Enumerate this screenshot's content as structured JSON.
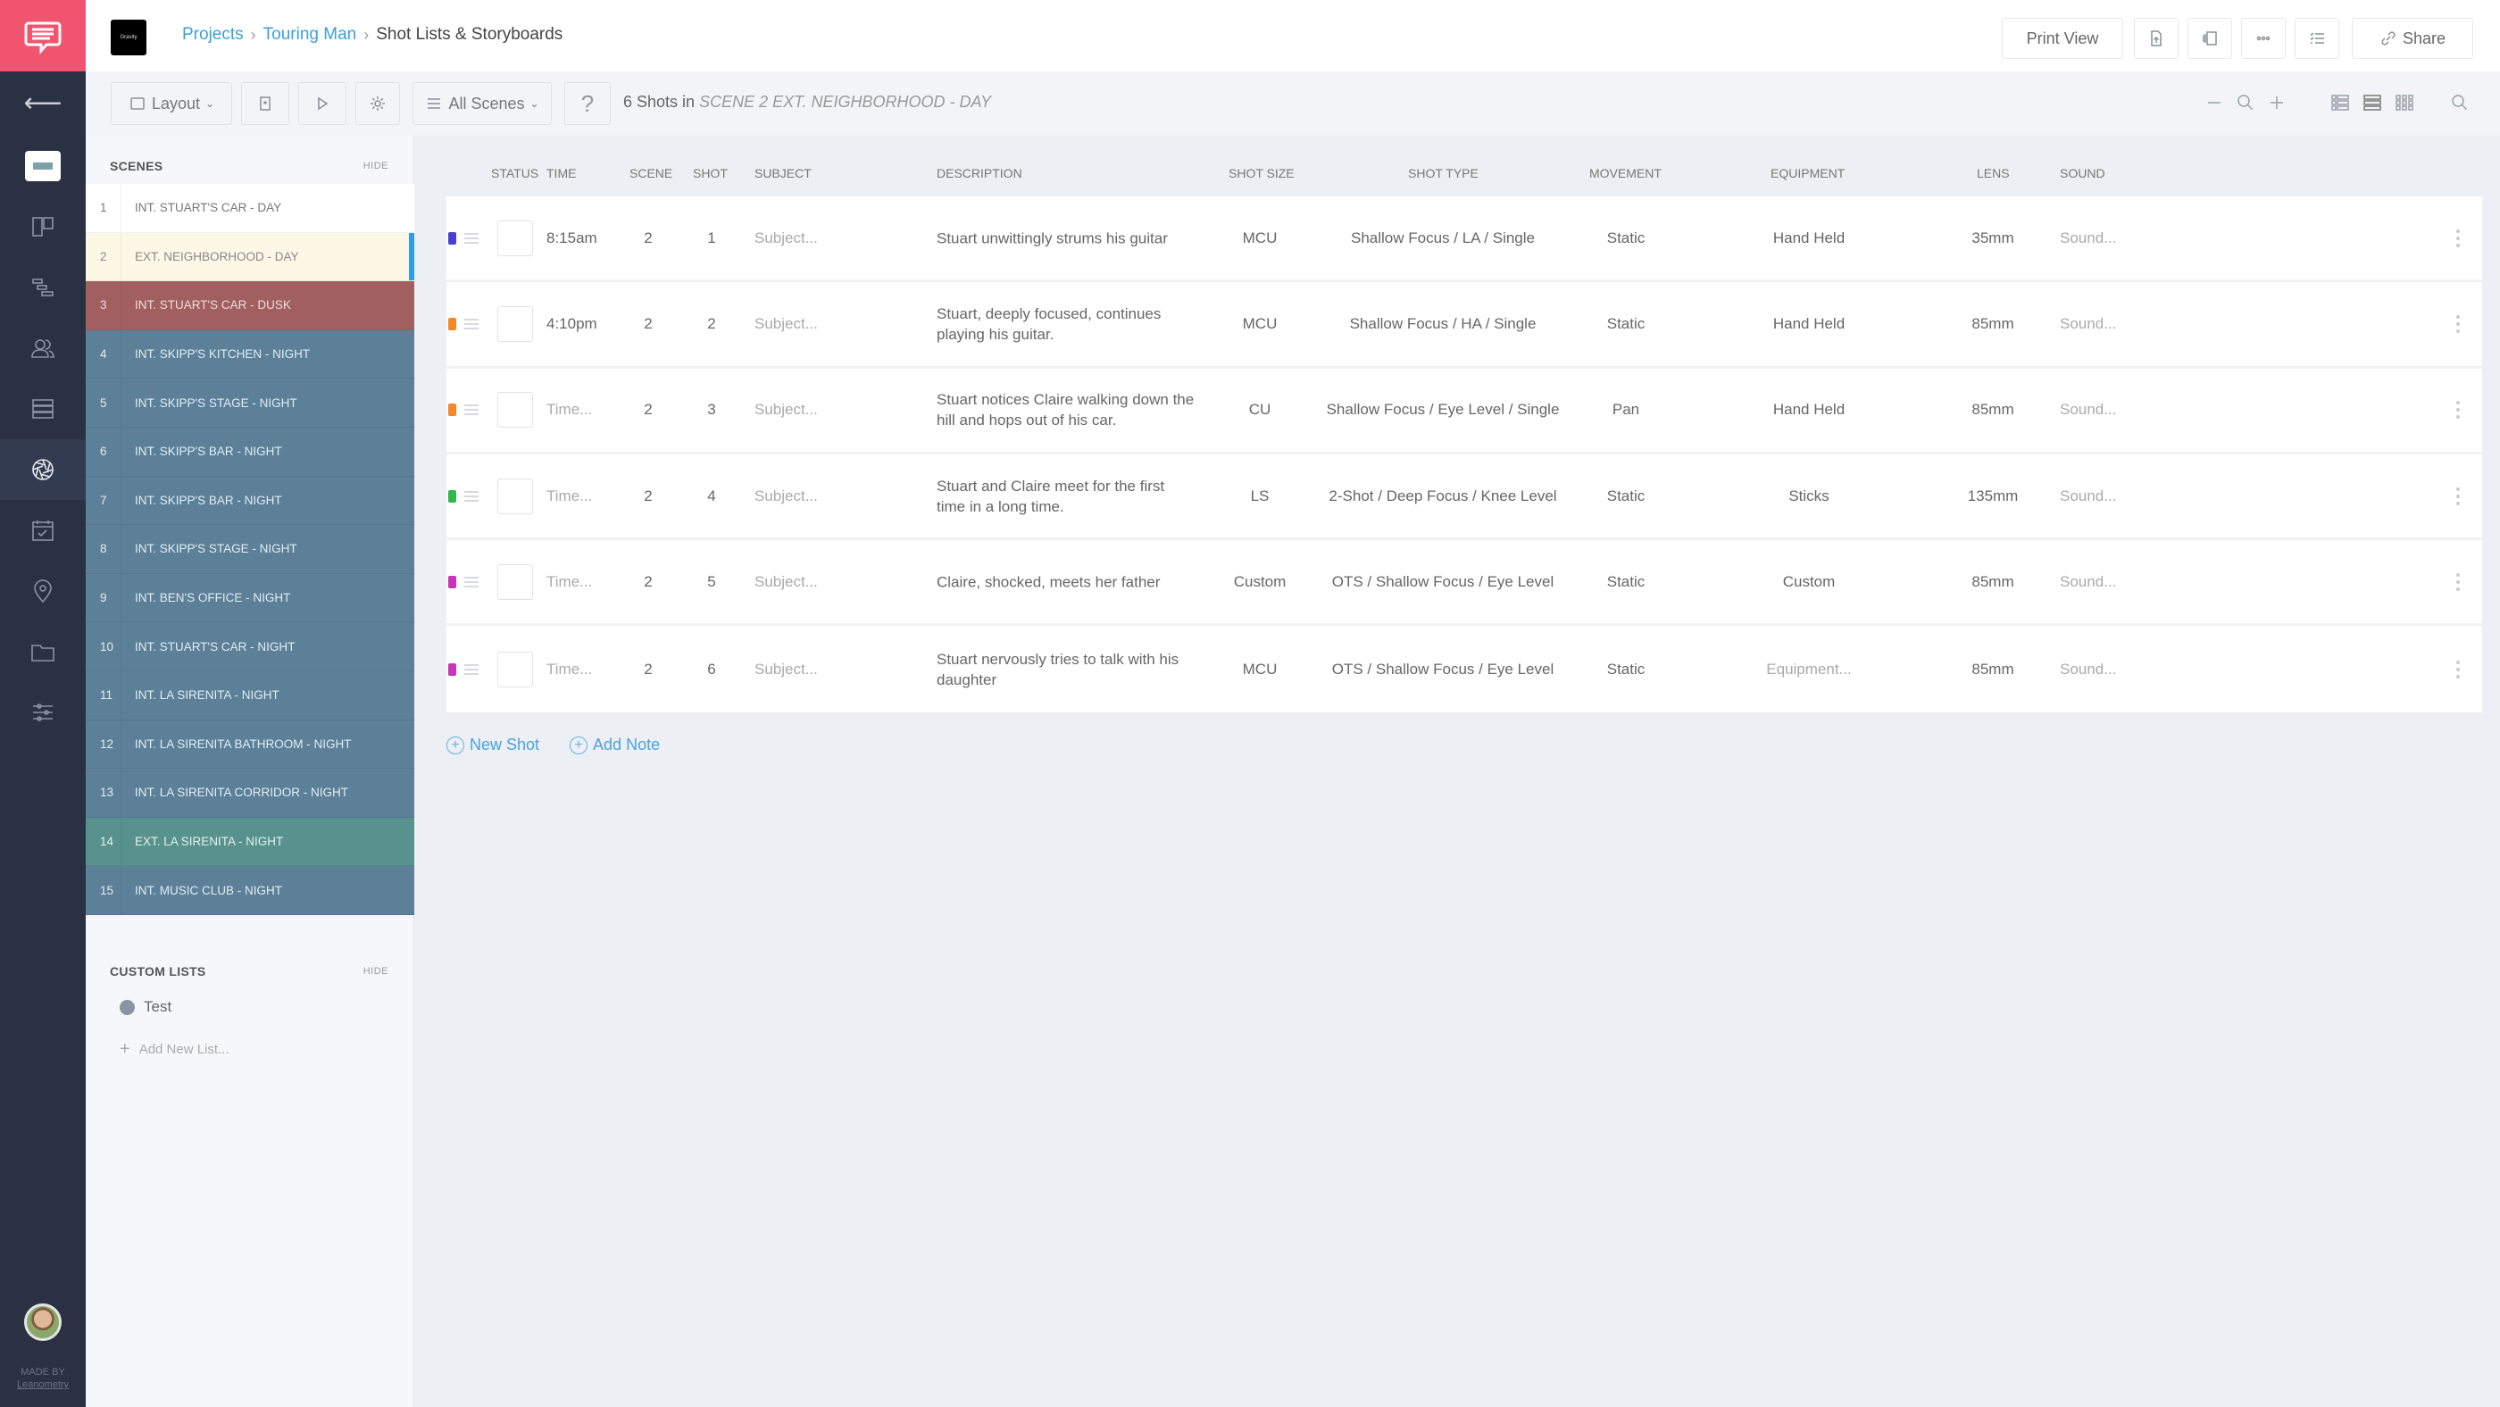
{
  "app": {
    "made_by_line1": "MADE BY",
    "made_by_line2": "Leanometry"
  },
  "header": {
    "project_thumb_label": "Gravity",
    "breadcrumb": [
      {
        "label": "Projects",
        "link": true
      },
      {
        "label": "Touring Man",
        "link": true
      },
      {
        "label": "Shot Lists & Storyboards",
        "link": false
      }
    ],
    "print_view_label": "Print View",
    "share_label": "Share"
  },
  "toolbar": {
    "layout_label": "Layout",
    "scene_filter_label": "All Scenes",
    "help_label": "?",
    "shots_count_prefix": "6 Shots in",
    "shots_count_scene": "SCENE 2 EXT. NEIGHBORHOOD - DAY"
  },
  "scenes_panel": {
    "title": "SCENES",
    "hide_label": "HIDE",
    "selected_index": 2,
    "scenes": [
      {
        "num": "1",
        "name": "INT. STUART'S CAR - DAY",
        "color": "#ffffff"
      },
      {
        "num": "2",
        "name": "EXT. NEIGHBORHOOD - DAY",
        "color": "#fdf7e6"
      },
      {
        "num": "3",
        "name": "INT. STUART'S CAR - DUSK",
        "color": "#a25f5f"
      },
      {
        "num": "4",
        "name": "INT. SKIPP'S KITCHEN - NIGHT",
        "color": "#5b8098"
      },
      {
        "num": "5",
        "name": "INT. SKIPP'S STAGE - NIGHT",
        "color": "#5b8098"
      },
      {
        "num": "6",
        "name": "INT. SKIPP'S BAR - NIGHT",
        "color": "#5b8098"
      },
      {
        "num": "7",
        "name": "INT. SKIPP'S BAR - NIGHT",
        "color": "#5b8098"
      },
      {
        "num": "8",
        "name": "INT. SKIPP'S STAGE - NIGHT",
        "color": "#5b8098"
      },
      {
        "num": "9",
        "name": "INT. BEN'S OFFICE - NIGHT",
        "color": "#5b8098"
      },
      {
        "num": "10",
        "name": "INT. STUART'S CAR - NIGHT",
        "color": "#5b8098"
      },
      {
        "num": "11",
        "name": "INT. LA SIRENITA - NIGHT",
        "color": "#5b8098"
      },
      {
        "num": "12",
        "name": "INT. LA SIRENITA BATHROOM - NIGHT",
        "color": "#5b8098"
      },
      {
        "num": "13",
        "name": "INT. LA SIRENITA CORRIDOR - NIGHT",
        "color": "#5b8098"
      },
      {
        "num": "14",
        "name": "EXT. LA SIRENITA - NIGHT",
        "color": "#58928d"
      },
      {
        "num": "15",
        "name": "INT. MUSIC CLUB - NIGHT",
        "color": "#5b8098"
      }
    ]
  },
  "custom_lists": {
    "title": "CUSTOM LISTS",
    "hide_label": "HIDE",
    "items": [
      {
        "label": "Test"
      }
    ],
    "add_label": "Add New List..."
  },
  "table": {
    "columns": {
      "status": "STATUS",
      "time": "TIME",
      "scene": "SCENE",
      "shot": "SHOT",
      "subject": "SUBJECT",
      "description": "DESCRIPTION",
      "shot_size": "SHOT SIZE",
      "shot_type": "SHOT TYPE",
      "movement": "MOVEMENT",
      "equipment": "EQUIPMENT",
      "lens": "LENS",
      "sound": "SOUND"
    },
    "rows": [
      {
        "tag_color": "#4b3fd1",
        "time": "8:15am",
        "time_placeholder": false,
        "scene": "2",
        "shot": "1",
        "subject": "Subject...",
        "description": "Stuart unwittingly strums his guitar",
        "shot_size": "MCU",
        "shot_type": "Shallow Focus / LA / Single",
        "movement": "Static",
        "equipment": "Hand Held",
        "equipment_placeholder": false,
        "lens": "35mm",
        "sound": "Sound..."
      },
      {
        "tag_color": "#f5862a",
        "time": "4:10pm",
        "time_placeholder": false,
        "scene": "2",
        "shot": "2",
        "subject": "Subject...",
        "description": "Stuart, deeply focused, continues playing his guitar.",
        "shot_size": "MCU",
        "shot_type": "Shallow Focus / HA / Single",
        "movement": "Static",
        "equipment": "Hand Held",
        "equipment_placeholder": false,
        "lens": "85mm",
        "sound": "Sound..."
      },
      {
        "tag_color": "#f5862a",
        "time": "Time...",
        "time_placeholder": true,
        "scene": "2",
        "shot": "3",
        "subject": "Subject...",
        "description": "Stuart notices Claire walking down the hill and hops out of his car.",
        "shot_size": "CU",
        "shot_type": "Shallow Focus / Eye Level / Single",
        "movement": "Pan",
        "equipment": "Hand Held",
        "equipment_placeholder": false,
        "lens": "85mm",
        "sound": "Sound..."
      },
      {
        "tag_color": "#2fb84f",
        "time": "Time...",
        "time_placeholder": true,
        "scene": "2",
        "shot": "4",
        "subject": "Subject...",
        "description": "Stuart and Claire meet for the first time in a long time.",
        "shot_size": "LS",
        "shot_type": "2-Shot / Deep Focus / Knee Level",
        "movement": "Static",
        "equipment": "Sticks",
        "equipment_placeholder": false,
        "lens": "135mm",
        "sound": "Sound..."
      },
      {
        "tag_color": "#c936b5",
        "time": "Time...",
        "time_placeholder": true,
        "scene": "2",
        "shot": "5",
        "subject": "Subject...",
        "description": "Claire, shocked, meets her father",
        "shot_size": "Custom",
        "shot_type": "OTS / Shallow Focus / Eye Level",
        "movement": "Static",
        "equipment": "Custom",
        "equipment_placeholder": false,
        "lens": "85mm",
        "sound": "Sound..."
      },
      {
        "tag_color": "#c936b5",
        "time": "Time...",
        "time_placeholder": true,
        "scene": "2",
        "shot": "6",
        "subject": "Subject...",
        "description": "Stuart nervously tries to talk with his daughter",
        "shot_size": "MCU",
        "shot_type": "OTS / Shallow Focus / Eye Level",
        "movement": "Static",
        "equipment": "Equipment...",
        "equipment_placeholder": true,
        "lens": "85mm",
        "sound": "Sound..."
      }
    ]
  },
  "actions": {
    "new_shot_label": "New Shot",
    "add_note_label": "Add Note"
  }
}
